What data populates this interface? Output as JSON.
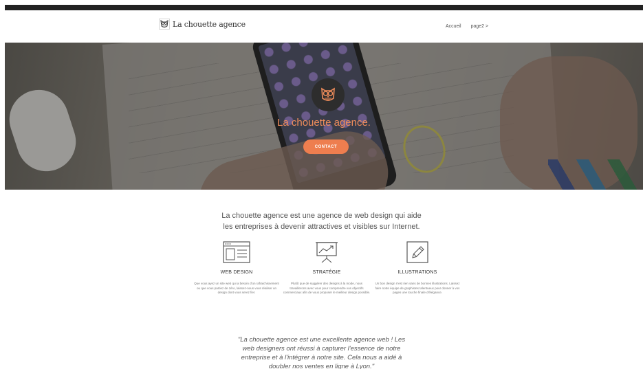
{
  "header": {
    "brand_name": "La chouette agence",
    "nav": [
      {
        "label": "Accueil"
      },
      {
        "label": "page2 >"
      }
    ]
  },
  "hero": {
    "title": "La chouette agence.",
    "cta_label": "CONTACT"
  },
  "intro": {
    "line1": "La chouette agence est une agence de web design qui aide",
    "line2": "les entreprises à devenir attractives et visibles sur Internet."
  },
  "features": [
    {
      "icon": "web-design-icon",
      "title": "WEB DESIGN",
      "description": "Que vous ayez un site web qui a besoin d'un rafraichissement ou que vous partiez de zéro, laissez-nous vous réaliser un design dont vous serez fier."
    },
    {
      "icon": "strategy-icon",
      "title": "STRATÉGIE",
      "description": "Plutôt que de suggérer des designs à la mode, nous travaillerons avec vous pour comprendre vos objectifs commerciaux afin de vous proposer le meilleur design possible."
    },
    {
      "icon": "illustration-icon",
      "title": "ILLUSTRATIONS",
      "description": "Un bon design n'est rien sans de bonnes illustrations. Laissez faire notre équipe de graphistes talentueux pour donner à vos pages une touche finale d'élégance."
    }
  ],
  "testimonial": {
    "line1": "\"La chouette agence est une excellente agence web ! Les",
    "line2": "web designers ont réussi à capturer l'essence de notre",
    "line3": "entreprise et à l'intégrer à notre site. Cela nous a aidé à",
    "line4": "doubler nos ventes en ligne à Lyon.\""
  },
  "colors": {
    "accent": "#ee7e4f",
    "topbar": "#222222",
    "hero_title": "#f08d5b"
  }
}
